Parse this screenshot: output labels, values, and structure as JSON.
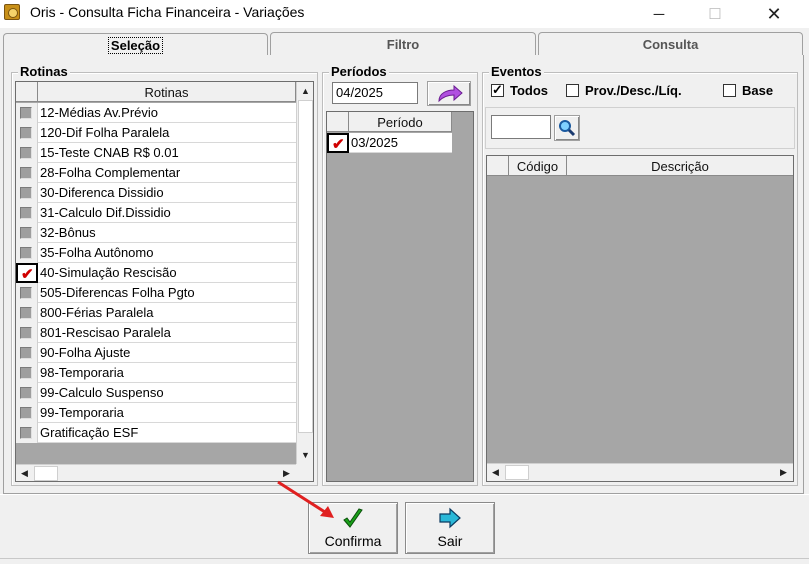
{
  "window": {
    "title": "Oris - Consulta Ficha Financeira - Variações",
    "minimize": "─",
    "maximize": "☐",
    "close": "✕"
  },
  "tabs": [
    {
      "label": "Seleção",
      "active": true
    },
    {
      "label": "Filtro",
      "active": false
    },
    {
      "label": "Consulta",
      "active": false
    }
  ],
  "rotinas": {
    "group_label": "Rotinas",
    "column_header": "Rotinas",
    "items": [
      {
        "label": "12-Médias Av.Prévio",
        "checked": false
      },
      {
        "label": "120-Dif Folha Paralela",
        "checked": false
      },
      {
        "label": "15-Teste CNAB R$ 0.01",
        "checked": false
      },
      {
        "label": "28-Folha Complementar",
        "checked": false
      },
      {
        "label": "30-Diferenca Dissidio",
        "checked": false
      },
      {
        "label": "31-Calculo Dif.Dissidio",
        "checked": false
      },
      {
        "label": "32-Bônus",
        "checked": false
      },
      {
        "label": "35-Folha Autônomo",
        "checked": false
      },
      {
        "label": "40-Simulação Rescisão",
        "checked": true
      },
      {
        "label": "505-Diferencas Folha Pgto",
        "checked": false
      },
      {
        "label": "800-Férias Paralela",
        "checked": false
      },
      {
        "label": "801-Rescisao Paralela",
        "checked": false
      },
      {
        "label": "90-Folha Ajuste",
        "checked": false
      },
      {
        "label": "98-Temporaria",
        "checked": false
      },
      {
        "label": "99-Calculo Suspenso",
        "checked": false
      },
      {
        "label": "99-Temporaria",
        "checked": false
      },
      {
        "label": "Gratificação ESF",
        "checked": false
      }
    ]
  },
  "periodos": {
    "group_label": "Períodos",
    "input_value": "04/2025",
    "column_header": "Período",
    "items": [
      {
        "label": "03/2025",
        "checked": true
      }
    ]
  },
  "eventos": {
    "group_label": "Eventos",
    "todos_label": "Todos",
    "todos_checked": true,
    "prov_label": "Prov./Desc./Líq.",
    "prov_checked": false,
    "base_label": "Base",
    "base_checked": false,
    "search_value": "",
    "columns": [
      "Código",
      "Descrição"
    ]
  },
  "buttons": {
    "confirma": "Confirma",
    "sair": "Sair"
  },
  "colors": {
    "check_mark": "#d00000",
    "arrow_annotation": "#e02020",
    "confirma_icon": "#1aa01a",
    "sair_icon": "#2ab8d8"
  }
}
